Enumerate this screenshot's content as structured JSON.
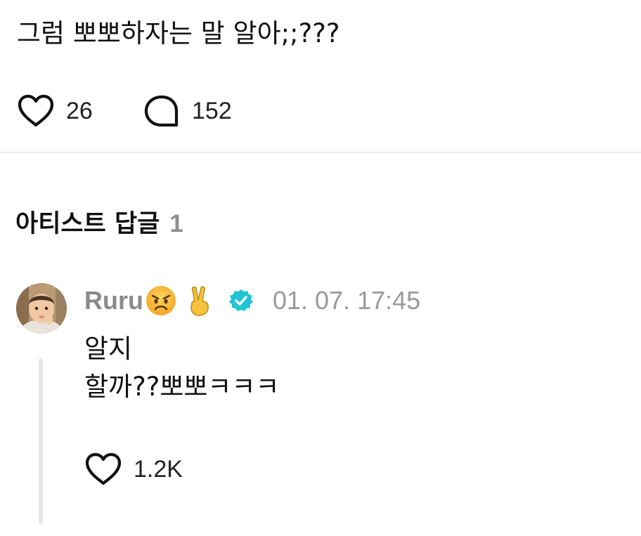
{
  "post": {
    "text": "그럼 뽀뽀하자는 말 알아;;???",
    "like_count": "26",
    "comment_count": "152",
    "like_icon": "heart-outline-icon",
    "comment_icon": "speech-bubble-icon"
  },
  "section": {
    "title": "아티스트 답글",
    "count": "1"
  },
  "reply": {
    "username": "Ruru",
    "emojis": [
      "angry-face-emoji",
      "victory-hand-emoji"
    ],
    "verified_icon": "verified-badge-icon",
    "verified_color": "#20c4d6",
    "timestamp": "01. 07. 17:45",
    "lines": [
      "알지",
      "할까??뽀뽀ㅋㅋㅋ"
    ],
    "like_count": "1.2K"
  }
}
